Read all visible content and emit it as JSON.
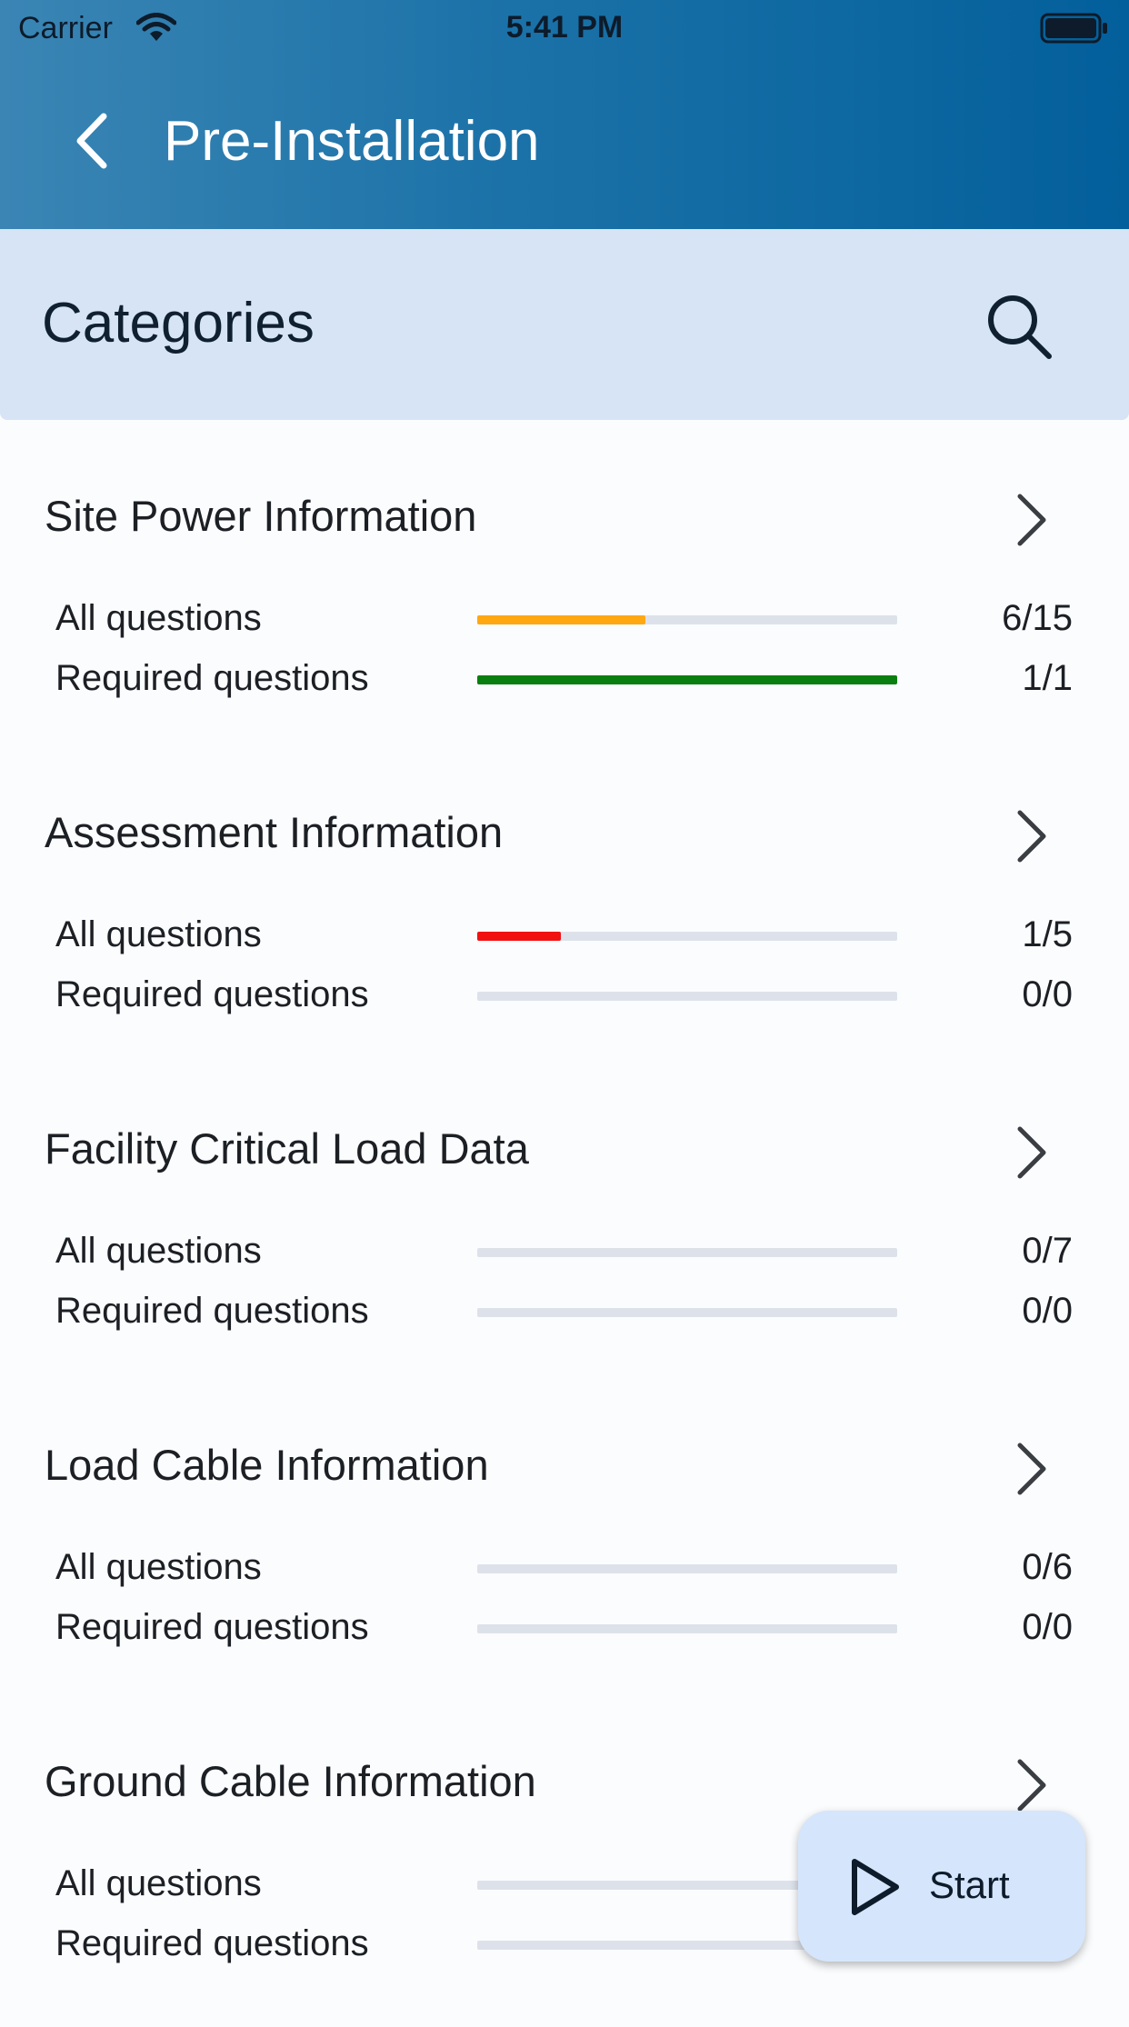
{
  "status_bar": {
    "carrier": "Carrier",
    "time": "5:41 PM"
  },
  "app_bar": {
    "title": "Pre-Installation",
    "back_icon": "chevron-left-icon"
  },
  "categories_header": {
    "label": "Categories",
    "search_icon": "search-icon"
  },
  "colors": {
    "orange": "#ffa812",
    "green": "#0a7f10",
    "red": "#f21111",
    "track": "#dde2ea"
  },
  "sections": [
    {
      "title": "Site Power Information",
      "all": {
        "label": "All questions",
        "count": "6/15",
        "progress": 0.4,
        "color": "#ffa812"
      },
      "required": {
        "label": "Required questions",
        "count": "1/1",
        "progress": 1.0,
        "color": "#0a7f10"
      }
    },
    {
      "title": "Assessment Information",
      "all": {
        "label": "All questions",
        "count": "1/5",
        "progress": 0.2,
        "color": "#f21111"
      },
      "required": {
        "label": "Required questions",
        "count": "0/0",
        "progress": 0,
        "color": "#dde2ea"
      }
    },
    {
      "title": "Facility Critical Load Data",
      "all": {
        "label": "All questions",
        "count": "0/7",
        "progress": 0,
        "color": "#dde2ea"
      },
      "required": {
        "label": "Required questions",
        "count": "0/0",
        "progress": 0,
        "color": "#dde2ea"
      }
    },
    {
      "title": "Load Cable Information",
      "all": {
        "label": "All questions",
        "count": "0/6",
        "progress": 0,
        "color": "#dde2ea"
      },
      "required": {
        "label": "Required questions",
        "count": "0/0",
        "progress": 0,
        "color": "#dde2ea"
      }
    },
    {
      "title": "Ground Cable Information",
      "all": {
        "label": "All questions",
        "count": "",
        "progress": 0,
        "color": "#dde2ea"
      },
      "required": {
        "label": "Required questions",
        "count": "",
        "progress": 0,
        "color": "#dde2ea"
      }
    }
  ],
  "fab": {
    "label": "Start",
    "icon": "play-icon"
  }
}
